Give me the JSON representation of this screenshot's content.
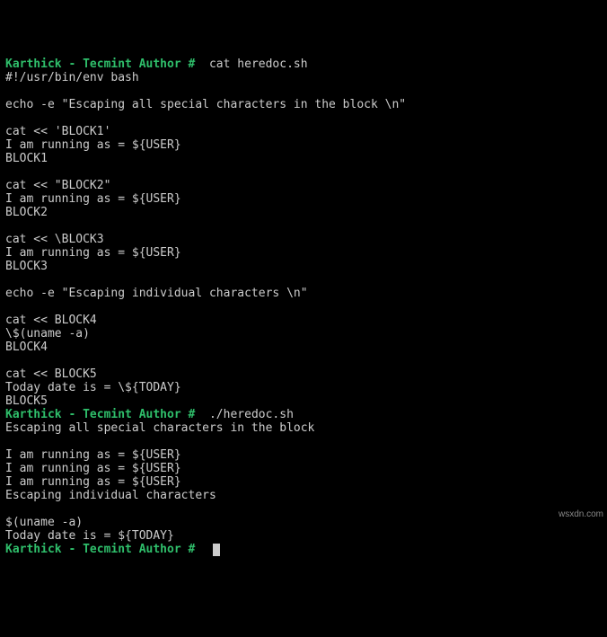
{
  "prompt": "Karthick - Tecmint Author # ",
  "cmd1": " cat heredoc.sh",
  "script": [
    "#!/usr/bin/env bash",
    "",
    "echo -e \"Escaping all special characters in the block \\n\"",
    "",
    "cat << 'BLOCK1'",
    "I am running as = ${USER}",
    "BLOCK1",
    "",
    "cat << \"BLOCK2\"",
    "I am running as = ${USER}",
    "BLOCK2",
    "",
    "cat << \\BLOCK3",
    "I am running as = ${USER}",
    "BLOCK3",
    "",
    "echo -e \"Escaping individual characters \\n\"",
    "",
    "cat << BLOCK4",
    "\\$(uname -a)",
    "BLOCK4",
    "",
    "cat << BLOCK5",
    "Today date is = \\${TODAY}",
    "BLOCK5"
  ],
  "cmd2": " ./heredoc.sh",
  "output": [
    "Escaping all special characters in the block ",
    "",
    "I am running as = ${USER}",
    "I am running as = ${USER}",
    "I am running as = ${USER}",
    "Escaping individual characters ",
    "",
    "$(uname -a)",
    "Today date is = ${TODAY}"
  ],
  "watermark": "wsxdn.com"
}
